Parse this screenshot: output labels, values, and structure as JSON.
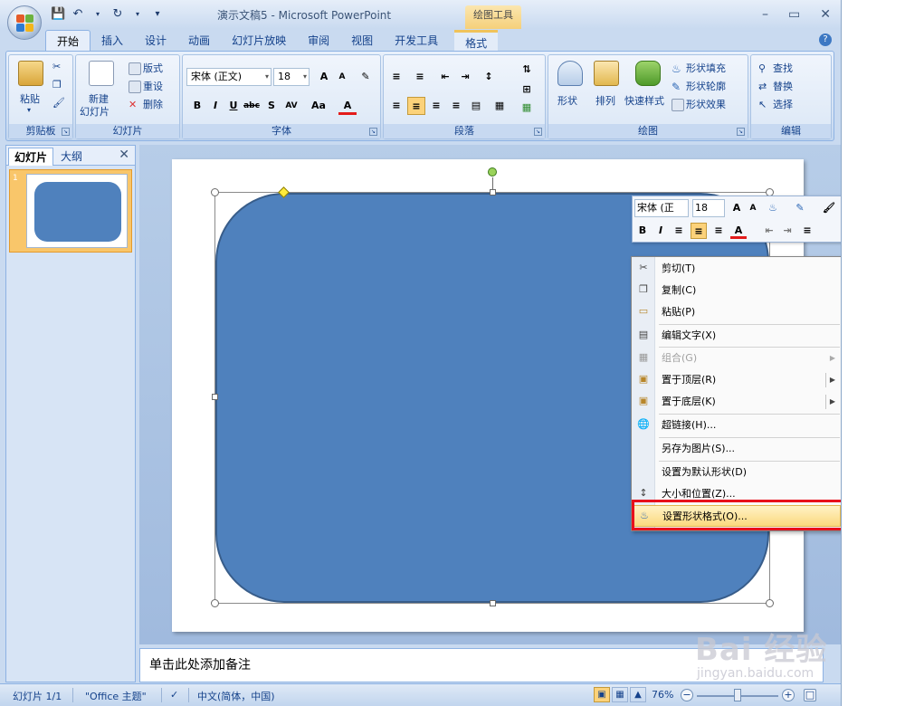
{
  "window": {
    "title": "演示文稿5 - Microsoft PowerPoint",
    "context_tool": "绘图工具"
  },
  "qat": {
    "icons": [
      "save-icon",
      "undo-icon",
      "redo-icon",
      "customize-icon"
    ]
  },
  "tabs": [
    "开始",
    "插入",
    "设计",
    "动画",
    "幻灯片放映",
    "审阅",
    "视图",
    "开发工具",
    "格式"
  ],
  "ribbon": {
    "clipboard": {
      "label": "剪贴板",
      "paste": "粘贴"
    },
    "slides": {
      "label": "幻灯片",
      "new_slide": "新建",
      "new_slide2": "幻灯片",
      "layout": "版式",
      "reset": "重设",
      "delete": "删除"
    },
    "font": {
      "label": "字体",
      "name": "宋体 (正文)",
      "size": "18",
      "bold": "B",
      "italic": "I",
      "underline": "U",
      "strike": "abc",
      "shadow": "S",
      "spacing": "AV",
      "case": "Aa",
      "color": "A",
      "grow": "A",
      "shrink": "A"
    },
    "paragraph": {
      "label": "段落"
    },
    "drawing": {
      "label": "绘图",
      "shapes": "形状",
      "arrange": "排列",
      "quick_styles": "快速样式",
      "fill": "形状填充",
      "outline": "形状轮廓",
      "effects": "形状效果"
    },
    "editing": {
      "label": "编辑",
      "find": "查找",
      "replace": "替换",
      "select": "选择"
    }
  },
  "left_panel": {
    "tab_slides": "幻灯片",
    "tab_outline": "大纲",
    "slide_number": "1"
  },
  "notes_placeholder": "单击此处添加备注",
  "statusbar": {
    "slide_info": "幻灯片 1/1",
    "theme": "\"Office 主题\"",
    "language": "中文(简体，中国)",
    "zoom": "76%",
    "zoom_level": 0.5
  },
  "mini_toolbar": {
    "font": "宋体 (正文)",
    "size": "18",
    "bold": "B",
    "italic": "I"
  },
  "context_menu": {
    "items": [
      {
        "label": "剪切(T)",
        "icon": "scissors-icon"
      },
      {
        "label": "复制(C)",
        "icon": "copy-icon"
      },
      {
        "label": "粘贴(P)",
        "icon": "paste-icon"
      },
      {
        "label": "编辑文字(X)",
        "icon": "text-box-icon"
      },
      {
        "label": "组合(G)",
        "icon": "group-icon",
        "disabled": true,
        "submenu": true
      },
      {
        "label": "置于顶层(R)",
        "icon": "bring-front-icon",
        "submenu": true
      },
      {
        "label": "置于底层(K)",
        "icon": "send-back-icon",
        "submenu": true
      },
      {
        "label": "超链接(H)...",
        "icon": "hyperlink-icon"
      },
      {
        "label": "另存为图片(S)...",
        "icon": ""
      },
      {
        "label": "设置为默认形状(D)",
        "icon": ""
      },
      {
        "label": "大小和位置(Z)...",
        "icon": "size-position-icon"
      },
      {
        "label": "设置形状格式(O)...",
        "icon": "format-shape-icon",
        "highlight": true
      }
    ]
  },
  "colors": {
    "shape_fill": "#4f81bd",
    "shape_border": "#385d8a",
    "highlight_box": "#e8101c",
    "menu_highlight": "#fbd97e"
  },
  "watermark": {
    "brand": "Bai 经验",
    "url": "jingyan.baidu.com"
  }
}
